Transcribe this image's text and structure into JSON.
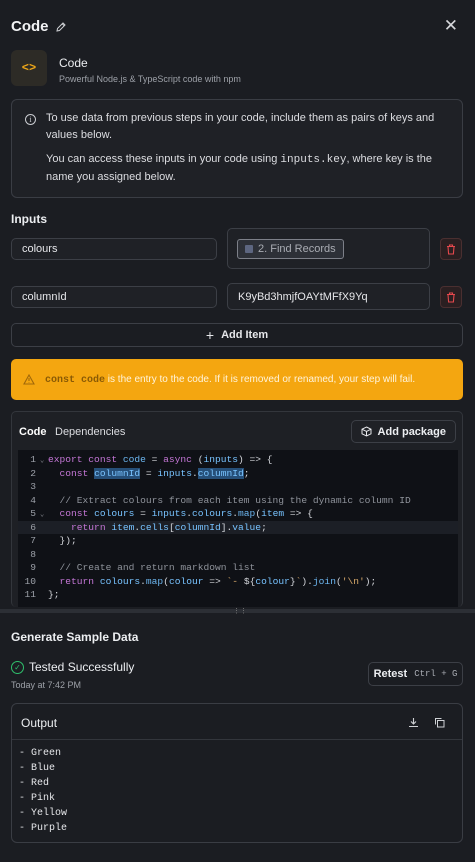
{
  "header": {
    "title": "Code"
  },
  "app": {
    "name": "Code",
    "description": "Powerful Node.js & TypeScript code with npm",
    "icon_glyph": "<>"
  },
  "info": {
    "line1": "To use data from previous steps in your code, include them as pairs of keys and values below.",
    "line2_prefix": "You can access these inputs in your code using ",
    "line2_code": "inputs.key",
    "line2_suffix": ", where key is the name you assigned below."
  },
  "inputs": {
    "label": "Inputs",
    "rows": [
      {
        "key": "colours",
        "value": "2. Find Records"
      },
      {
        "key": "columnId",
        "value": "K9yBd3hmjfOAYtMFfX9Yq"
      }
    ],
    "add_label": "Add Item"
  },
  "warning": {
    "code": "const code",
    "text": " is the entry to the code. If it is removed or renamed, your step will fail."
  },
  "code_tabs": {
    "code": "Code",
    "dependencies": "Dependencies",
    "add_package": "Add package"
  },
  "editor": {
    "line_numbers": [
      "1",
      "2",
      "3",
      "4",
      "5",
      "6",
      "7",
      "8",
      "9",
      "10",
      "11"
    ],
    "comment_extract": "// Extract colours from each item using the dynamic column ID",
    "comment_create": "// Create and return markdown list"
  },
  "generate": {
    "title": "Generate Sample Data",
    "status": "Tested Successfully",
    "time": "Today at 7:42 PM",
    "retest": "Retest",
    "shortcut": "Ctrl + G"
  },
  "output": {
    "title": "Output",
    "lines": [
      "- Green",
      "- Blue",
      "- Red",
      "- Pink",
      "- Yellow",
      "- Purple"
    ]
  },
  "colors": {
    "background": "#1b1d22",
    "warning": "#f4a610",
    "success": "#2fbf6c",
    "danger": "#e5484d"
  }
}
